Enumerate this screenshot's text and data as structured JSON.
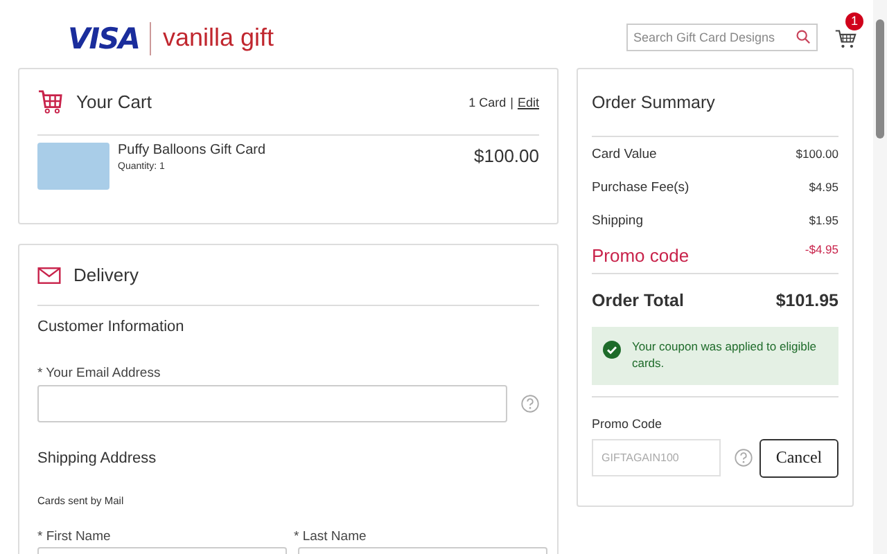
{
  "header": {
    "logo_visa": "VISA",
    "logo_brand": "vanilla gift",
    "search": {
      "placeholder": "Search Gift Card Designs"
    },
    "cart_badge": "1"
  },
  "cart": {
    "title": "Your Cart",
    "count": "1 Card",
    "separator": "|",
    "edit_link": "Edit",
    "items": [
      {
        "name": "Puffy Balloons Gift Card",
        "quantity": "Quantity: 1",
        "price": "$100.00"
      }
    ]
  },
  "delivery": {
    "title": "Delivery",
    "customer_heading": "Customer Information",
    "email_label": "* Your Email Address",
    "shipping_heading": "Shipping Address",
    "shipping_note": "Cards sent by Mail",
    "first_name_label": "* First Name",
    "last_name_label": "* Last Name"
  },
  "summary": {
    "title": "Order Summary",
    "lines": [
      {
        "kind": "normal",
        "label": "Card Value",
        "amount": "$100.00"
      },
      {
        "kind": "normal",
        "label": "Purchase Fee(s)",
        "amount": "$4.95"
      },
      {
        "kind": "normal",
        "label": "Shipping",
        "amount": "$1.95"
      },
      {
        "kind": "promo",
        "label": "Promo code",
        "amount": "-$4.95"
      }
    ],
    "total_label": "Order Total",
    "total_amount": "$101.95",
    "success_message": "Your coupon was applied to eligible cards.",
    "promo_label": "Promo Code",
    "promo": {
      "value": "GIFTAGAIN100",
      "disabled": true
    },
    "cancel_button": "Cancel"
  }
}
